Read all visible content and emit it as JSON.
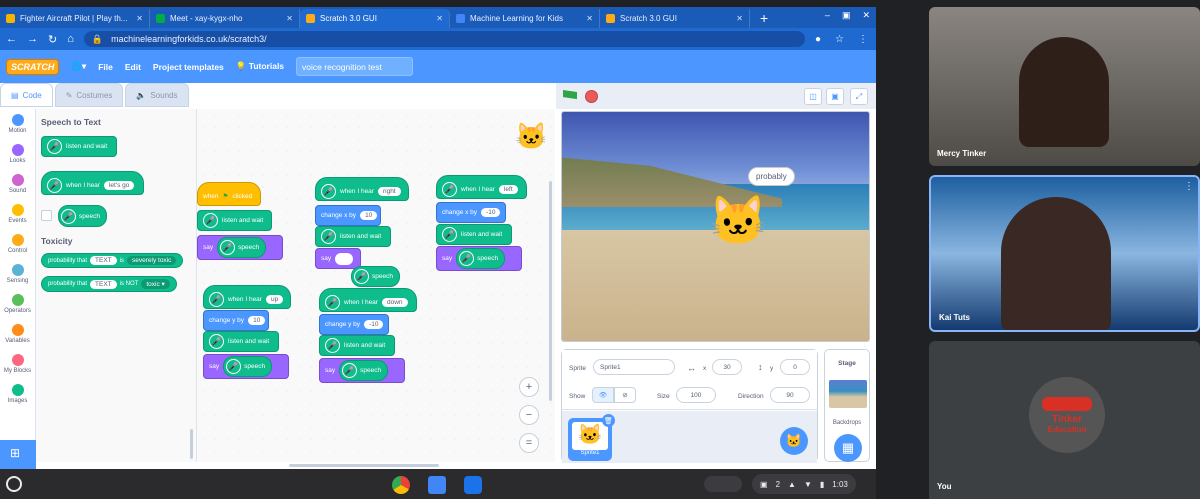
{
  "browser": {
    "tabs": [
      {
        "title": "Fighter Aircraft Pilot | Play th...",
        "color": "#f4b400",
        "active": false
      },
      {
        "title": "Meet - xay-kygx-nho",
        "color": "#00ac47",
        "active": false
      },
      {
        "title": "Scratch 3.0 GUI",
        "color": "#ffab19",
        "active": true
      },
      {
        "title": "Machine Learning for Kids",
        "color": "#4285f4",
        "active": false
      },
      {
        "title": "Scratch 3.0 GUI",
        "color": "#ffab19",
        "active": false
      }
    ],
    "new_tab": "+",
    "url": "machinelearningforkids.co.uk/scratch3/"
  },
  "menubar": {
    "logo": "SCRATCH",
    "file": "File",
    "edit": "Edit",
    "project_templates": "Project templates",
    "tutorials": "Tutorials",
    "project_name": "voice recognition test"
  },
  "editor_tabs": {
    "code": "Code",
    "costumes": "Costumes",
    "sounds": "Sounds"
  },
  "categories": [
    {
      "label": "Motion",
      "color": "#4c97ff"
    },
    {
      "label": "Looks",
      "color": "#9966ff"
    },
    {
      "label": "Sound",
      "color": "#cf63cf"
    },
    {
      "label": "Events",
      "color": "#ffbf00"
    },
    {
      "label": "Control",
      "color": "#ffab19"
    },
    {
      "label": "Sensing",
      "color": "#5cb1d6"
    },
    {
      "label": "Operators",
      "color": "#59c059"
    },
    {
      "label": "Variables",
      "color": "#ff8c1a"
    },
    {
      "label": "My Blocks",
      "color": "#ff6680"
    },
    {
      "label": "Images",
      "color": "#0fbd8c"
    }
  ],
  "palette": {
    "heading1": "Speech to Text",
    "listen": "listen and wait",
    "when_hear": "when I hear",
    "lets_go": "let's go",
    "speech": "speech",
    "heading2": "Toxicity",
    "prob1_a": "probability that",
    "prob1_text": "TEXT",
    "prob1_b": "is",
    "prob1_val": "severely toxic",
    "prob2_a": "probability that",
    "prob2_text": "TEXT",
    "prob2_b": "is NOT",
    "prob2_val": "toxic"
  },
  "scripts": {
    "s1_hat": "when",
    "s1_clicked": "clicked",
    "listen": "listen and wait",
    "say": "say",
    "speech": "speech",
    "when_hear": "when I hear",
    "right": "right",
    "left": "left",
    "up": "up",
    "down": "down",
    "change_x": "change x by",
    "change_y": "change y by",
    "v10": "10",
    "vm10": "-10"
  },
  "stage": {
    "bubble": "probably"
  },
  "sprite_info": {
    "sprite_label": "Sprite",
    "sprite_name": "Sprite1",
    "x_label": "x",
    "x": "30",
    "y_label": "y",
    "y": "0",
    "show_label": "Show",
    "size_label": "Size",
    "size": "100",
    "direction_label": "Direction",
    "direction": "90",
    "thumb_label": "Sprite1"
  },
  "stage_panel": {
    "title": "Stage",
    "backdrops": "Backdrops"
  },
  "taskbar": {
    "notif_count": "2",
    "time": "1:03"
  },
  "meet": {
    "p1": "Mercy Tinker",
    "p2": "Kai Tuts",
    "p3": "You",
    "logo_line1": "Tinker",
    "logo_line2": "Education"
  }
}
